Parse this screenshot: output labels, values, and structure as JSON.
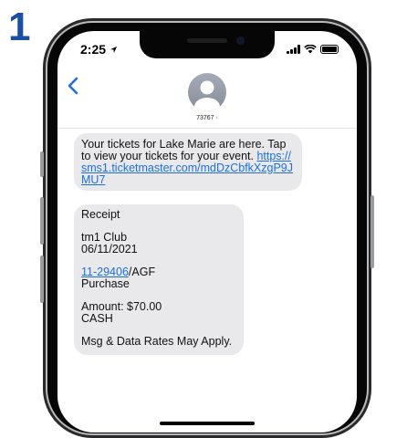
{
  "step": {
    "number": "1"
  },
  "status_bar": {
    "time": "2:25",
    "location_arrow": "location-arrow-icon"
  },
  "header": {
    "contact": "73767",
    "chevron": "›"
  },
  "messages": {
    "first": {
      "text": "Your tickets for Lake Marie are here. Tap to view your tickets for your event. ",
      "link": "https://sms1.ticketmaster.com/mdDzCbfkXzgP9JMU7"
    },
    "receipt": {
      "title": "Receipt",
      "venue": "tm1 Club",
      "date": "06/11/2021",
      "order_link": "11-29406",
      "order_suffix": "/AGF",
      "order_type": "Purchase",
      "amount": "Amount: $70.00",
      "payment": "CASH",
      "disclaimer": "Msg & Data Rates May Apply."
    }
  },
  "colors": {
    "accent": "#1e6fe0",
    "step_number": "#1a4fa3",
    "bubble": "#e9e9eb"
  }
}
